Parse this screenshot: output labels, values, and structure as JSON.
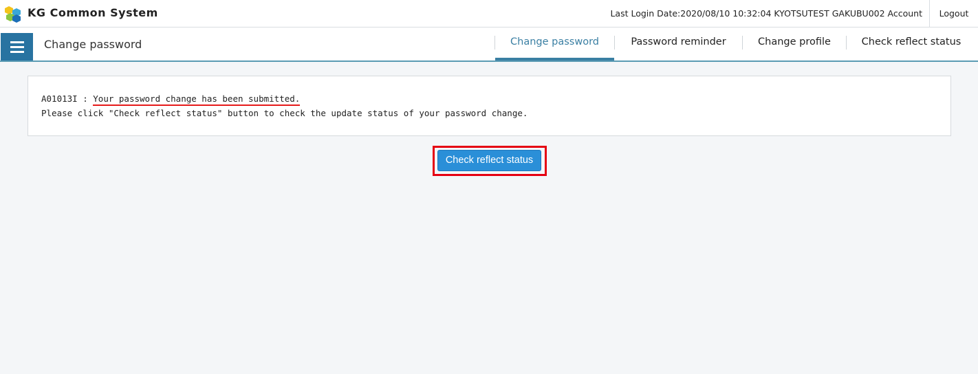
{
  "header": {
    "app_title": "KG Common System",
    "login_info": "Last Login Date:2020/08/10 10:32:04  KYOTSUTEST GAKUBU002 Account",
    "logout_label": "Logout",
    "logo_icon": "kg-cube-logo"
  },
  "subheader": {
    "menu_icon": "hamburger-menu-icon",
    "page_title": "Change password",
    "tabs": [
      {
        "label": "Change password",
        "active": true
      },
      {
        "label": "Password reminder",
        "active": false
      },
      {
        "label": "Change profile",
        "active": false
      },
      {
        "label": "Check reflect status",
        "active": false
      }
    ]
  },
  "message": {
    "code": "A01013I  :",
    "text": "Your password change has been submitted.",
    "instruction": "Please click \"Check reflect status\" button to check the update status of your password change."
  },
  "action": {
    "button_label": "Check reflect status"
  },
  "colors": {
    "accent": "#3a7fa3",
    "menu_bg": "#2873a1",
    "button_bg": "#2a8fd8",
    "highlight": "#e50012"
  }
}
